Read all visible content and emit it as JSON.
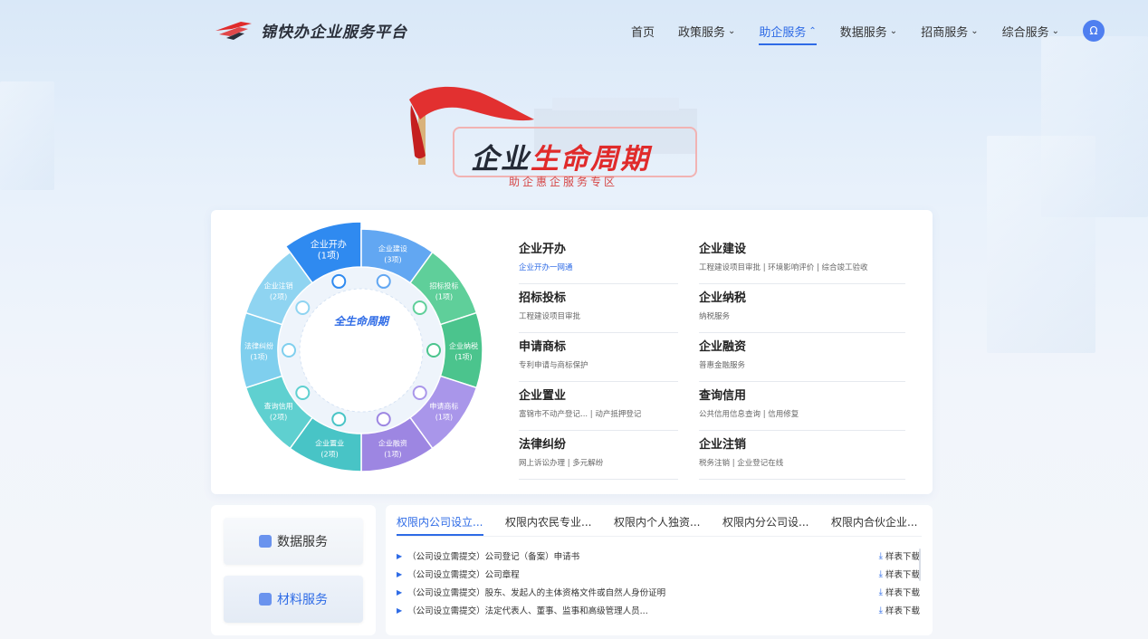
{
  "header": {
    "logo_text": "锦快办企业服务平台",
    "nav": [
      {
        "label": "首页",
        "dropdown": false,
        "active": false
      },
      {
        "label": "政策服务",
        "dropdown": true,
        "active": false
      },
      {
        "label": "助企服务",
        "dropdown": true,
        "active": true
      },
      {
        "label": "数据服务",
        "dropdown": true,
        "active": false
      },
      {
        "label": "招商服务",
        "dropdown": true,
        "active": false
      },
      {
        "label": "综合服务",
        "dropdown": true,
        "active": false
      }
    ],
    "avatar_icon": "user-icon"
  },
  "hero": {
    "title_part1": "企业",
    "title_part2": "生命周期",
    "subtitle": "助企惠企服务专区"
  },
  "wheel": {
    "center_label": "全生命周期",
    "segments": [
      {
        "name": "企业开办",
        "count": "(1项)"
      },
      {
        "name": "企业建设",
        "count": "(3项)"
      },
      {
        "name": "招标投标",
        "count": "(1项)"
      },
      {
        "name": "企业纳税",
        "count": "(1项)"
      },
      {
        "name": "申请商标",
        "count": "(1项)"
      },
      {
        "name": "企业融资",
        "count": "(1项)"
      },
      {
        "name": "企业置业",
        "count": "(2项)"
      },
      {
        "name": "查询信用",
        "count": "(2项)"
      },
      {
        "name": "法律纠纷",
        "count": "(1项)"
      },
      {
        "name": "企业注销",
        "count": "(2项)"
      }
    ]
  },
  "categories_left": [
    {
      "title": "企业开办",
      "sub": "企业开办一网通",
      "highlight": true
    },
    {
      "title": "招标投标",
      "sub": "工程建设项目审批",
      "highlight": false
    },
    {
      "title": "申请商标",
      "sub": "专利申请与商标保护",
      "highlight": false
    },
    {
      "title": "企业置业",
      "sub": "富锦市不动产登记...  |  动产抵押登记",
      "highlight": false
    },
    {
      "title": "法律纠纷",
      "sub": "网上诉讼办理  |  多元解纷",
      "highlight": false
    }
  ],
  "categories_right": [
    {
      "title": "企业建设",
      "sub": "工程建设项目审批  |  环境影响评价  |  综合竣工验收",
      "highlight": false
    },
    {
      "title": "企业纳税",
      "sub": "纳税服务",
      "highlight": false
    },
    {
      "title": "企业融资",
      "sub": "普惠金融服务",
      "highlight": false
    },
    {
      "title": "查询信用",
      "sub": "公共信用信息查询  |  信用修复",
      "highlight": false
    },
    {
      "title": "企业注销",
      "sub": "税务注销  |  企业登记在线",
      "highlight": false
    }
  ],
  "side": {
    "data_service": "数据服务",
    "material_service": "材料服务"
  },
  "tabs": [
    "权限内公司设立...",
    "权限内农民专业...",
    "权限内个人独资...",
    "权限内分公司设...",
    "权限内合伙企业..."
  ],
  "rows": [
    "（公司设立需提交）公司登记（备案）申请书",
    "（公司设立需提交）公司章程",
    "（公司设立需提交）股东、发起人的主体资格文件或自然人身份证明",
    "（公司设立需提交）法定代表人、董事、监事和高级管理人员..."
  ],
  "download_label": "样表下载",
  "colors": {
    "accent": "#2e6be6",
    "red": "#e02b2b"
  }
}
